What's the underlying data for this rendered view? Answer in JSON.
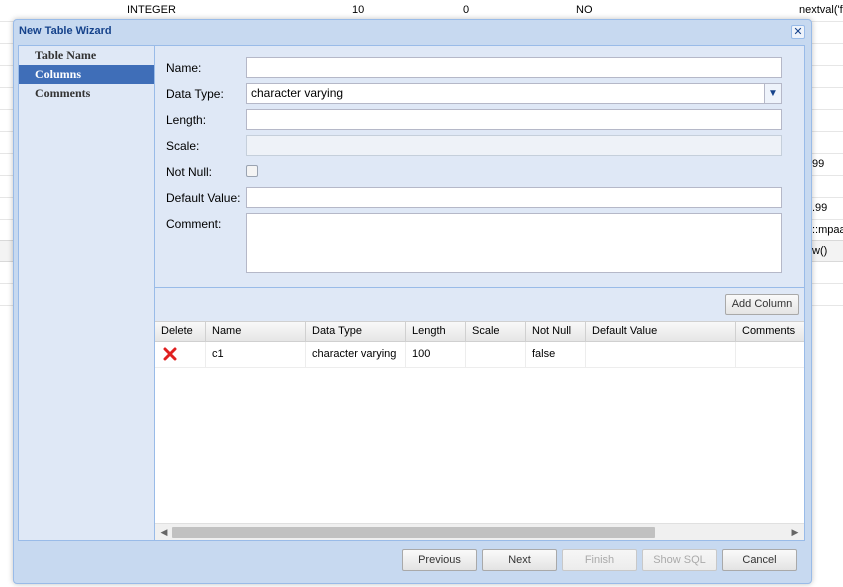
{
  "background": {
    "header_row": {
      "type": "INTEGER",
      "length": "10",
      "scale": "0",
      "not_null": "NO",
      "default": "nextval('f"
    },
    "partial_texts": {
      "r1": "99",
      "r2": ".99",
      "r3": "::mpaa",
      "r4": "w()"
    }
  },
  "dialog": {
    "title": "New Table Wizard",
    "close_glyph": "✕"
  },
  "nav": {
    "items": [
      {
        "label": "Table Name"
      },
      {
        "label": "Columns"
      },
      {
        "label": "Comments"
      }
    ],
    "active_index": 1
  },
  "form": {
    "name_label": "Name:",
    "name_value": "",
    "datatype_label": "Data Type:",
    "datatype_value": "character varying",
    "length_label": "Length:",
    "length_value": "",
    "scale_label": "Scale:",
    "scale_value": "",
    "notnull_label": "Not Null:",
    "notnull_checked": false,
    "default_label": "Default Value:",
    "default_value": "",
    "comment_label": "Comment:",
    "comment_value": ""
  },
  "grid": {
    "add_column_label": "Add Column",
    "columns": [
      "Delete",
      "Name",
      "Data Type",
      "Length",
      "Scale",
      "Not Null",
      "Default Value",
      "Comments"
    ],
    "rows": [
      {
        "name": "c1",
        "data_type": "character varying",
        "length": "100",
        "scale": "",
        "not_null": "false",
        "default_value": "",
        "comments": ""
      }
    ]
  },
  "buttons": {
    "previous": "Previous",
    "next": "Next",
    "finish": "Finish",
    "show_sql": "Show SQL",
    "cancel": "Cancel"
  },
  "colors": {
    "dialog_bg": "#c7d9f0",
    "panel_bg": "#dfe8f6",
    "accent": "#3f6eb8",
    "title_text": "#15428b",
    "delete_icon": "#e02020"
  },
  "icons": {
    "delete": "red-x-icon",
    "dropdown": "chevron-down-icon",
    "close": "close-icon",
    "scroll_left": "arrow-left-icon",
    "scroll_right": "arrow-right-icon"
  }
}
